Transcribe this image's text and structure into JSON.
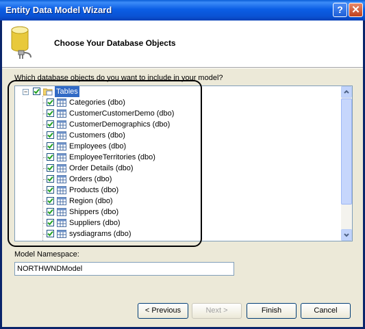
{
  "window": {
    "title": "Entity Data Model Wizard",
    "help_glyph": "?",
    "close_glyph": "✕"
  },
  "header": {
    "title": "Choose Your Database Objects"
  },
  "prompt": "Which database objects do you want to include in your model?",
  "tree": {
    "root_label": "Tables",
    "items": [
      "Categories (dbo)",
      "CustomerCustomerDemo (dbo)",
      "CustomerDemographics (dbo)",
      "Customers (dbo)",
      "Employees (dbo)",
      "EmployeeTerritories (dbo)",
      "Order Details (dbo)",
      "Orders (dbo)",
      "Products (dbo)",
      "Region (dbo)",
      "Shippers (dbo)",
      "Suppliers (dbo)",
      "sysdiagrams (dbo)"
    ]
  },
  "namespace": {
    "label": "Model Namespace:",
    "value": "NORTHWNDModel"
  },
  "buttons": {
    "previous": "< Previous",
    "next": "Next >",
    "finish": "Finish",
    "cancel": "Cancel"
  },
  "colors": {
    "accent": "#316ac5",
    "titlebar": "#0a5ed8",
    "check": "#21a121"
  }
}
